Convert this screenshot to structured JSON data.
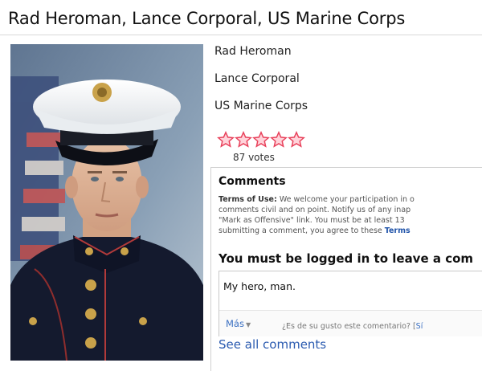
{
  "page": {
    "title": "Rad Heroman, Lance Corporal, US Marine Corps"
  },
  "profile": {
    "name": "Rad Heroman",
    "rank": "Lance Corporal",
    "branch": "US Marine Corps"
  },
  "rating": {
    "stars_filled": 5,
    "stars_total": 5,
    "votes_label": "87 votes",
    "star_color": "#e8405a"
  },
  "comments": {
    "heading": "Comments",
    "terms_label": "Terms of Use:",
    "terms_line1": " We welcome your participation in o",
    "terms_line2": "comments civil and on point. Notify us of any inap",
    "terms_line3": "\"Mark as Offensive\" link. You must be at least 13",
    "terms_line4": "submitting a comment, you agree to these ",
    "terms_link": "Terms",
    "login_message": "You must be logged in to leave a com",
    "comment_text": "My hero, man.",
    "more_label": "Más",
    "likes_question": "¿Es de su gusto este comentario? [",
    "likes_yes": "Sí",
    "see_all_label": "See all comments"
  },
  "photo": {
    "alt_semantic": "marine-portrait",
    "icon": "portrait-photo"
  }
}
